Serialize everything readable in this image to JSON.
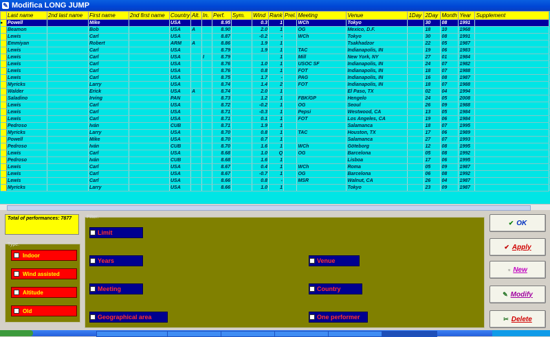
{
  "window": {
    "title": "Modifica LONG JUMP"
  },
  "grid": {
    "columns": [
      "Last name",
      "2nd last name",
      "First name",
      "2nd first name",
      "Country",
      "Alt.",
      "In.",
      "Perf.",
      "Sym.",
      "Wind",
      "Rank",
      "Prel.",
      "Meeting",
      "Venue",
      "1Day",
      "2Day",
      "Month",
      "Year",
      "Supplement"
    ],
    "rows": [
      [
        "Powell",
        "",
        "Mike",
        "",
        "USA",
        "",
        "",
        "8.95",
        "",
        "0.3",
        "1",
        "",
        "WCh",
        "Tokyo",
        "",
        "30",
        "08",
        "1991",
        ""
      ],
      [
        "Beamon",
        "",
        "Bob",
        "",
        "USA",
        "A",
        "",
        "8.90",
        "",
        "2.0",
        "1",
        "",
        "OG",
        "Mexico, D.F.",
        "",
        "18",
        "10",
        "1968",
        ""
      ],
      [
        "Lewis",
        "",
        "Carl",
        "",
        "USA",
        "",
        "",
        "8.87",
        "",
        "-0.2",
        "-",
        "",
        "WCh",
        "Tokyo",
        "",
        "30",
        "08",
        "1991",
        ""
      ],
      [
        "Emmiyan",
        "",
        "Robert",
        "",
        "ARM",
        "A",
        "",
        "8.86",
        "",
        "1.9",
        "1",
        "",
        "",
        "Tsakhadzor",
        "",
        "22",
        "05",
        "1987",
        ""
      ],
      [
        "Lewis",
        "",
        "Carl",
        "",
        "USA",
        "",
        "",
        "8.79",
        "",
        "1.9",
        "1",
        "",
        "TAC",
        "Indianapolis, IN",
        "",
        "19",
        "06",
        "1983",
        ""
      ],
      [
        "Lewis",
        "",
        "Carl",
        "",
        "USA",
        "",
        "I",
        "8.79",
        "",
        "",
        "1",
        "",
        "Mill",
        "New York, NY",
        "",
        "27",
        "01",
        "1984",
        ""
      ],
      [
        "Lewis",
        "",
        "Carl",
        "",
        "USA",
        "",
        "",
        "8.76",
        "",
        "1.0",
        "1",
        "",
        "USOC SF",
        "Indianapolis, IN",
        "",
        "24",
        "07",
        "1982",
        ""
      ],
      [
        "Lewis",
        "",
        "Carl",
        "",
        "USA",
        "",
        "",
        "8.76",
        "",
        "0.8",
        "1",
        "",
        "FOT",
        "Indianapolis, IN",
        "",
        "18",
        "07",
        "1988",
        ""
      ],
      [
        "Lewis",
        "",
        "Carl",
        "",
        "USA",
        "",
        "",
        "8.75",
        "",
        "1.7",
        "-",
        "",
        "PAG",
        "Indianapolis, IN",
        "",
        "16",
        "08",
        "1987",
        ""
      ],
      [
        "Myricks",
        "",
        "Larry",
        "",
        "USA",
        "",
        "",
        "8.74",
        "",
        "1.4",
        "2",
        "",
        "FOT",
        "Indianapolis, IN",
        "",
        "18",
        "07",
        "1988",
        ""
      ],
      [
        "Walder",
        "",
        "Erick",
        "",
        "USA",
        "A",
        "",
        "8.74",
        "",
        "2.0",
        "1",
        "",
        "",
        "El Paso, TX",
        "",
        "02",
        "04",
        "1994",
        ""
      ],
      [
        "Saladino",
        "",
        "Irving",
        "",
        "PAN",
        "",
        "",
        "8.73",
        "",
        "1.2",
        "1",
        "",
        "FBK/GP",
        "Hengelo",
        "",
        "24",
        "05",
        "2008",
        ""
      ],
      [
        "Lewis",
        "",
        "Carl",
        "",
        "USA",
        "",
        "",
        "8.72",
        "",
        "-0.2",
        "1",
        "",
        "OG",
        "Seoul",
        "",
        "26",
        "09",
        "1988",
        ""
      ],
      [
        "Lewis",
        "",
        "Carl",
        "",
        "USA",
        "",
        "",
        "8.71",
        "",
        "-0.3",
        "1",
        "",
        "Pepsi",
        "Westwood, CA",
        "",
        "13",
        "05",
        "1984",
        ""
      ],
      [
        "Lewis",
        "",
        "Carl",
        "",
        "USA",
        "",
        "",
        "8.71",
        "",
        "0.1",
        "1",
        "",
        "FOT",
        "Los Angeles, CA",
        "",
        "19",
        "06",
        "1984",
        ""
      ],
      [
        "Pedroso",
        "",
        "Iván",
        "",
        "CUB",
        "",
        "",
        "8.71",
        "",
        "1.9",
        "1",
        "",
        "",
        "Salamanca",
        "",
        "18",
        "07",
        "1995",
        ""
      ],
      [
        "Myricks",
        "",
        "Larry",
        "",
        "USA",
        "",
        "",
        "8.70",
        "",
        "0.8",
        "1",
        "",
        "TAC",
        "Houston, TX",
        "",
        "17",
        "06",
        "1989",
        ""
      ],
      [
        "Powell",
        "",
        "Mike",
        "",
        "USA",
        "",
        "",
        "8.70",
        "",
        "0.7",
        "1",
        "",
        "",
        "Salamanca",
        "",
        "27",
        "07",
        "1993",
        ""
      ],
      [
        "Pedroso",
        "",
        "Iván",
        "",
        "CUB",
        "",
        "",
        "8.70",
        "",
        "1.6",
        "1",
        "",
        "WCh",
        "Göteborg",
        "",
        "12",
        "08",
        "1995",
        ""
      ],
      [
        "Lewis",
        "",
        "Carl",
        "",
        "USA",
        "",
        "",
        "8.68",
        "",
        "1.0",
        "Q",
        "",
        "OG",
        "Barcelona",
        "",
        "05",
        "08",
        "1992",
        ""
      ],
      [
        "Pedroso",
        "",
        "Iván",
        "",
        "CUB",
        "",
        "",
        "8.68",
        "",
        "1.6",
        "1",
        "",
        "",
        "Lisboa",
        "",
        "17",
        "06",
        "1995",
        ""
      ],
      [
        "Lewis",
        "",
        "Carl",
        "",
        "USA",
        "",
        "",
        "8.67",
        "",
        "0.4",
        "1",
        "",
        "WCh",
        "Roma",
        "",
        "05",
        "09",
        "1987",
        ""
      ],
      [
        "Lewis",
        "",
        "Carl",
        "",
        "USA",
        "",
        "",
        "8.67",
        "",
        "-0.7",
        "1",
        "",
        "OG",
        "Barcelona",
        "",
        "06",
        "08",
        "1992",
        ""
      ],
      [
        "Lewis",
        "",
        "Carl",
        "",
        "USA",
        "",
        "",
        "8.66",
        "",
        "0.8",
        "-",
        "",
        "MSR",
        "Walnut, CA",
        "",
        "26",
        "04",
        "1987",
        ""
      ],
      [
        "Myricks",
        "",
        "Larry",
        "",
        "USA",
        "",
        "",
        "8.66",
        "",
        "1.0",
        "1",
        "",
        "",
        "Tokyo",
        "",
        "23",
        "09",
        "1987",
        ""
      ]
    ]
  },
  "total": {
    "label": "Total of performances: 7877"
  },
  "type": {
    "legend": "Type:",
    "items": [
      "Indoor",
      "Wind assisted",
      "Altitude",
      "Old"
    ]
  },
  "filter": {
    "legend": "Filter:",
    "limit": "Limit",
    "years": "Years",
    "venue": "Venue",
    "meeting": "Meeting",
    "country": "Country",
    "geo": "Geographical area",
    "one": "One performer"
  },
  "actions": {
    "ok": "OK",
    "apply": "Apply",
    "new": "New",
    "modify": "Modify",
    "delete": "Delete"
  },
  "colors": {
    "grid_bg": "#00e5e5",
    "header_bg": "#ffff00",
    "selected_row": "#0000a0",
    "filter_panel": "#808000",
    "type_button": "#ff0000",
    "filter_button": "#000090"
  }
}
